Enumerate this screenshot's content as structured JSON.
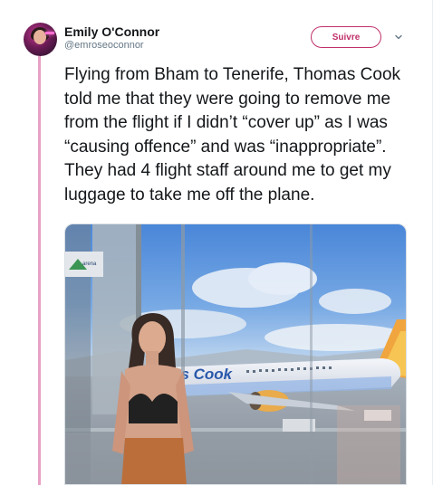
{
  "author": {
    "name": "Emily O'Connor",
    "handle": "@emroseoconnor"
  },
  "follow_button": {
    "label": "Suivre"
  },
  "tweet": {
    "text": "Flying from Bham to Tenerife, Thomas Cook told me that they were going to remove me from the flight if I didn’t “cover up” as I was “causing offence” and was “inappropriate”. They had 4 flight staff around me to get my luggage to take me off the plane."
  },
  "media": {
    "aircraft_livery_text": "as Cook",
    "sign_text": "arena"
  },
  "icons": {
    "avatar": "profile-photo",
    "caret": "chevron-down-icon"
  },
  "colors": {
    "accent": "#c0306a",
    "thread_line": "#e8a1c6",
    "handle_gray": "#657786"
  }
}
